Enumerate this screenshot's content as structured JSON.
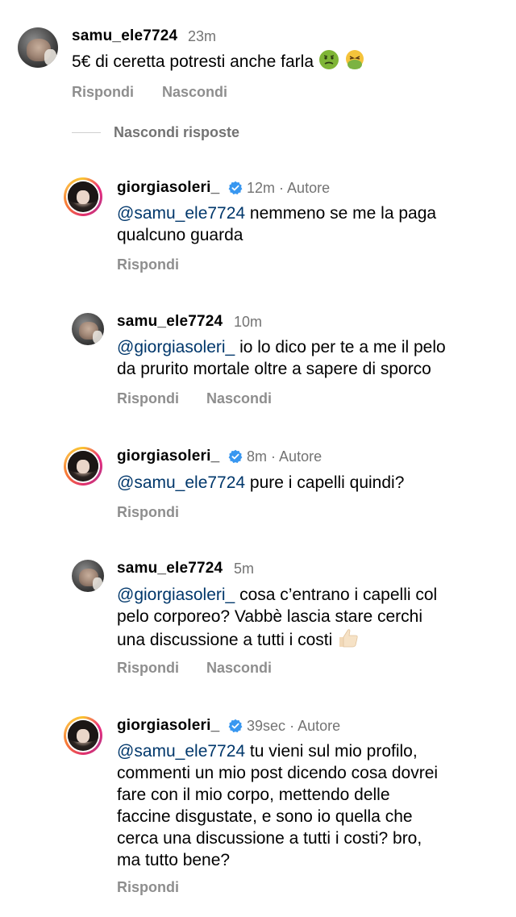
{
  "colors": {
    "mention": "#00376b",
    "secondary_text": "#737373",
    "action_text": "#8e8e8e",
    "verified_badge": "#3897f0"
  },
  "labels": {
    "reply": "Rispondi",
    "hide": "Nascondi",
    "author": "Autore",
    "hide_replies": "Nascondi risposte",
    "separator": "·"
  },
  "top_comment": {
    "username": "samu_ele7724",
    "time": "23m",
    "text": "5€ di ceretta potresti anche farla",
    "emojis": [
      "nauseated-face-emoji",
      "vomiting-face-emoji"
    ]
  },
  "replies": [
    {
      "username": "giorgiasoleri_",
      "verified": true,
      "time": "12m",
      "is_author": true,
      "mention": "@samu_ele7724",
      "lines": [
        " nemmeno se me la paga",
        "qualcuno guarda"
      ]
    },
    {
      "username": "samu_ele7724",
      "verified": false,
      "time": "10m",
      "is_author": false,
      "mention": "@giorgiasoleri_",
      "lines": [
        " io lo dico per te a me il pelo",
        "da prurito mortale oltre a sapere di sporco"
      ]
    },
    {
      "username": "giorgiasoleri_",
      "verified": true,
      "time": "8m",
      "is_author": true,
      "mention": "@samu_ele7724",
      "lines": [
        " pure i capelli quindi?"
      ]
    },
    {
      "username": "samu_ele7724",
      "verified": false,
      "time": "5m",
      "is_author": false,
      "mention": "@giorgiasoleri_",
      "lines": [
        " cosa c’entrano i capelli col",
        "pelo corporeo? Vabbè lascia stare cerchi",
        "una discussione a tutti i costi"
      ],
      "emojis": [
        "thumbs-up-emoji"
      ]
    },
    {
      "username": "giorgiasoleri_",
      "verified": true,
      "time": "39sec",
      "is_author": true,
      "mention": "@samu_ele7724",
      "lines": [
        " tu vieni sul mio profilo,",
        "commenti un mio post dicendo cosa dovrei",
        "fare con il mio corpo, mettendo delle",
        "faccine disgustate, e sono io quella che",
        "cerca una discussione a tutti i costi?  bro,",
        "ma tutto bene?"
      ]
    }
  ]
}
